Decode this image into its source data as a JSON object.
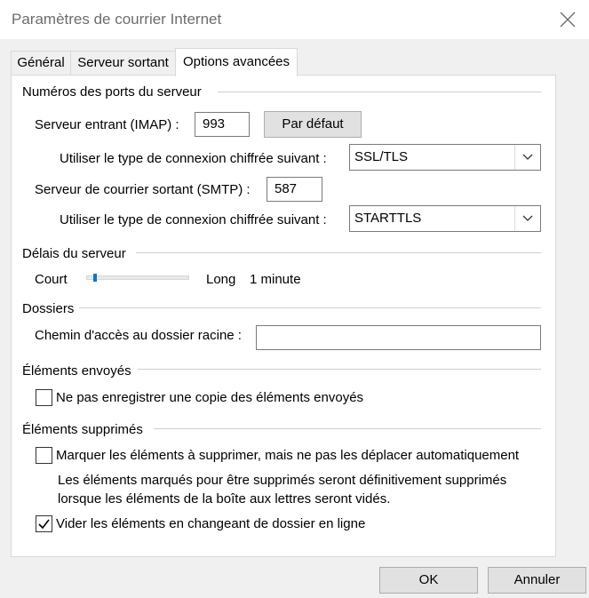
{
  "window": {
    "title": "Paramètres de courrier Internet",
    "close_icon": "close-icon"
  },
  "tabs": [
    {
      "label": "Général",
      "active": false
    },
    {
      "label": "Serveur sortant",
      "active": false
    },
    {
      "label": "Options avancées",
      "active": true
    }
  ],
  "ports": {
    "group_title": "Numéros des ports du serveur",
    "incoming_label": "Serveur entrant (IMAP) :",
    "incoming_value": "993",
    "default_button": "Par défaut",
    "incoming_encryption_label": "Utiliser le type de connexion chiffrée suivant :",
    "incoming_encryption_value": "SSL/TLS",
    "outgoing_label": "Serveur de courrier sortant (SMTP) :",
    "outgoing_value": "587",
    "outgoing_encryption_label": "Utiliser le type de connexion chiffrée suivant :",
    "outgoing_encryption_value": "STARTTLS"
  },
  "timeouts": {
    "group_title": "Délais du serveur",
    "short_label": "Court",
    "long_label": "Long",
    "value_label": "1 minute"
  },
  "folders": {
    "group_title": "Dossiers",
    "root_path_label": "Chemin d'accès au dossier racine :",
    "root_path_value": ""
  },
  "sent_items": {
    "group_title": "Éléments envoyés",
    "no_copy_label": "Ne pas enregistrer une copie des éléments envoyés",
    "no_copy_checked": false
  },
  "deleted_items": {
    "group_title": "Éléments supprimés",
    "mark_label": "Marquer les éléments à supprimer, mais ne pas les déplacer automatiquement",
    "mark_checked": false,
    "description_line1": "Les éléments marqués pour être supprimés seront définitivement supprimés",
    "description_line2": "lorsque les éléments de la boîte aux lettres seront vidés.",
    "purge_label": "Vider les éléments en changeant de dossier en ligne",
    "purge_checked": true
  },
  "footer": {
    "ok_button": "OK",
    "cancel_button": "Annuler"
  },
  "colors": {
    "accent": "#0078d7",
    "panel_bg": "#ffffff",
    "window_bg": "#f0f0f0"
  }
}
